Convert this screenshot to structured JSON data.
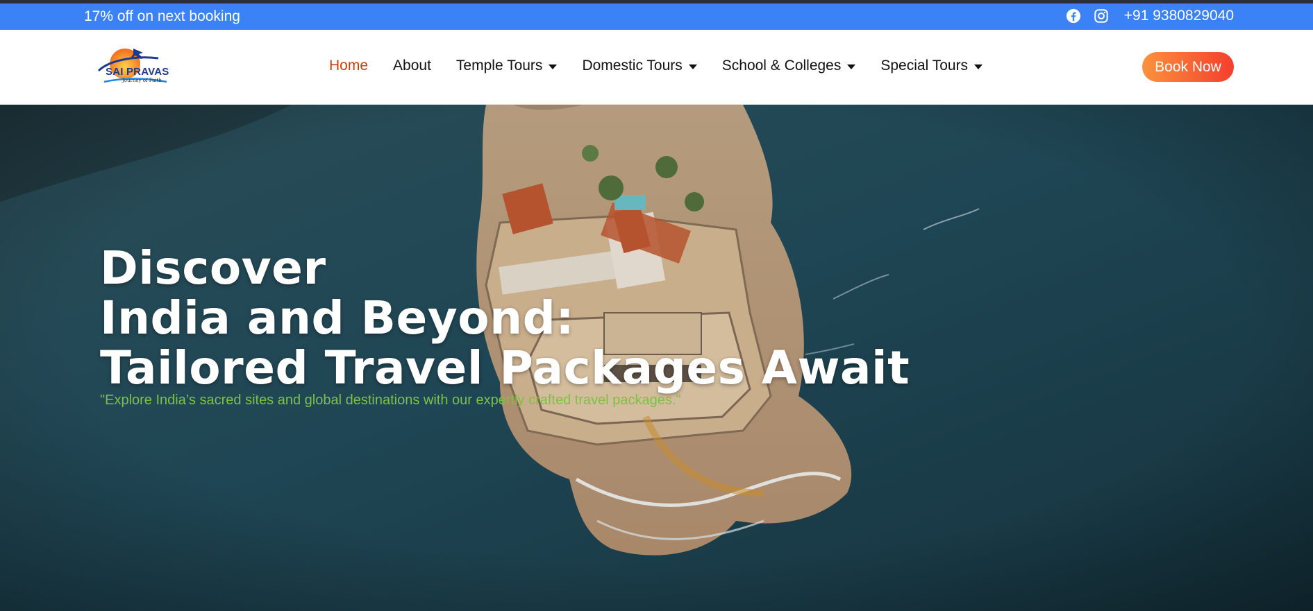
{
  "topbar": {
    "promo": "17% off on next booking",
    "icons": [
      "facebook-icon",
      "instagram-icon"
    ],
    "phone": "+91 9380829040",
    "background": "#3b82f6"
  },
  "logo": {
    "brand": "SAI PRAVAS",
    "tagline": "Journey of Faith"
  },
  "nav": {
    "items": [
      {
        "label": "Home",
        "active": true,
        "dropdown": false
      },
      {
        "label": "About",
        "active": false,
        "dropdown": false
      },
      {
        "label": "Temple Tours",
        "active": false,
        "dropdown": true
      },
      {
        "label": "Domestic Tours",
        "active": false,
        "dropdown": true
      },
      {
        "label": "School & Colleges",
        "active": false,
        "dropdown": true
      },
      {
        "label": "Special Tours",
        "active": false,
        "dropdown": true
      }
    ],
    "active_color": "#c2410c",
    "cta": "Book Now"
  },
  "hero": {
    "line1": "Discover",
    "line2": "India and Beyond:",
    "line3": "Tailored Travel Packages Await",
    "subtitle": "\"Explore India’s sacred sites and global destinations with our expertly crafted travel packages.\"",
    "subtitle_color": "#7cc244"
  }
}
